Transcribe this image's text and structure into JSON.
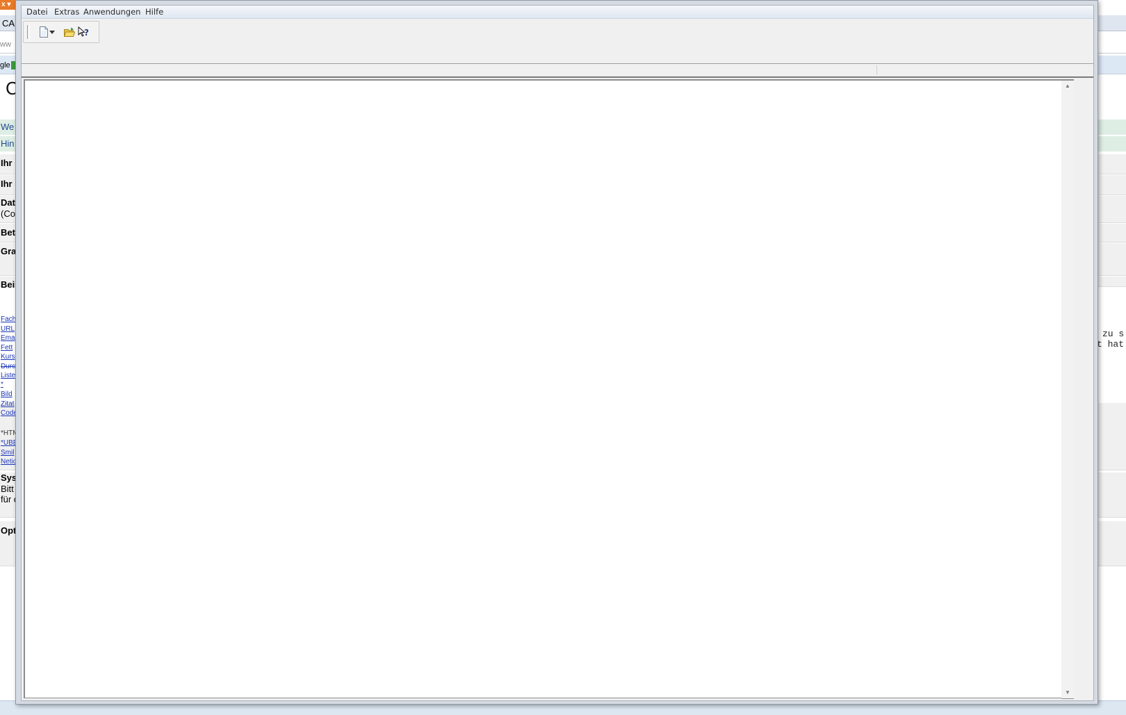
{
  "background_page": {
    "tab_title": "CA",
    "address": "ww",
    "bookmark": "gle",
    "logo_fragment": "C",
    "rows": [
      {
        "label": "We",
        "style": "link"
      },
      {
        "label": "Hin",
        "style": "link"
      },
      {
        "label": "Ihr",
        "style": "bold"
      },
      {
        "label": "Ihr",
        "style": "bold"
      },
      {
        "label": "Dat",
        "style": "bold"
      },
      {
        "label": "(Co",
        "style": "plain"
      },
      {
        "label": "Bet",
        "style": "bold"
      },
      {
        "label": "Gra",
        "style": "bold"
      },
      {
        "label": "Bei",
        "style": "bold"
      }
    ],
    "small_links": [
      "Fach",
      "URL",
      "Ema",
      "Fett",
      "Kurs",
      "Durc",
      "Liste",
      "*",
      "Bild",
      "Zitat",
      "Code",
      "*HTM",
      "*UBE",
      "Smil",
      "Netic"
    ],
    "lower_labels": [
      "Sys",
      "Bitt",
      "für c",
      "Opt"
    ],
    "right_text": [
      "zu s",
      "t hat"
    ]
  },
  "window": {
    "menu": [
      "Datei",
      "Extras",
      "Anwendungen",
      "Hilfe"
    ],
    "toolbar": {
      "buttons": [
        {
          "name": "new-document-icon"
        },
        {
          "name": "new-dropdown-arrow-icon"
        },
        {
          "name": "open-folder-icon"
        },
        {
          "name": "context-help-icon"
        }
      ]
    },
    "editor_content": "",
    "scroll_up": "▲",
    "scroll_down": "▼"
  }
}
